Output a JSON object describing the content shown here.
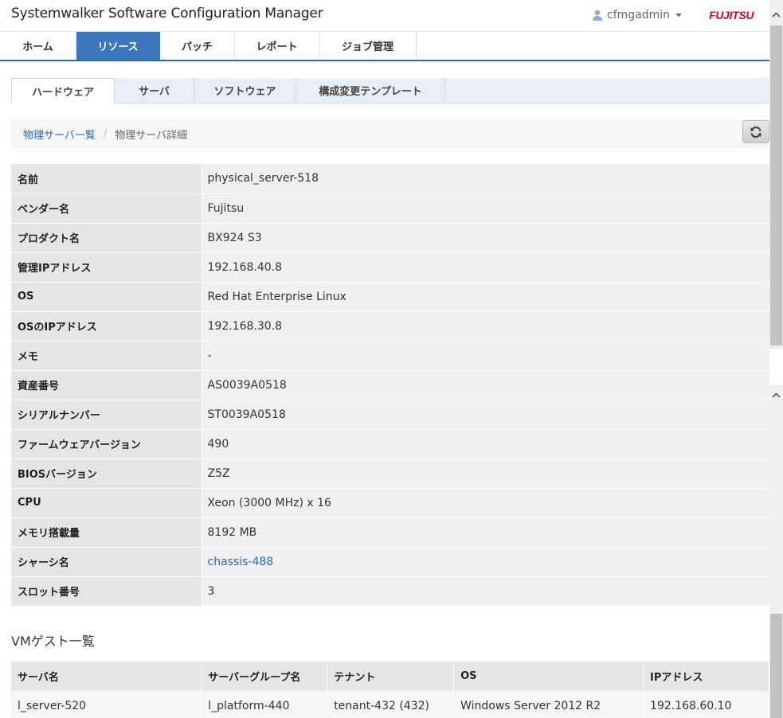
{
  "header": {
    "app_title": "Systemwalker Software Configuration Manager",
    "user_name": "cfmgadmin",
    "brand": "FUJITSU"
  },
  "main_nav": {
    "tabs": [
      {
        "label": "ホーム",
        "active": false
      },
      {
        "label": "リソース",
        "active": true
      },
      {
        "label": "パッチ",
        "active": false
      },
      {
        "label": "レポート",
        "active": false
      },
      {
        "label": "ジョブ管理",
        "active": false
      }
    ]
  },
  "sub_nav": {
    "tabs": [
      {
        "label": "ハードウェア",
        "active": true
      },
      {
        "label": "サーバ",
        "active": false
      },
      {
        "label": "ソフトウェア",
        "active": false
      },
      {
        "label": "構成変更テンプレート",
        "active": false
      }
    ]
  },
  "breadcrumb": {
    "parent": "物理サーバ一覧",
    "separator": "/",
    "current": "物理サーバ詳細"
  },
  "details": [
    {
      "label": "名前",
      "value": "physical_server-518"
    },
    {
      "label": "ベンダー名",
      "value": "Fujitsu"
    },
    {
      "label": "プロダクト名",
      "value": "BX924 S3"
    },
    {
      "label": "管理IPアドレス",
      "value": "192.168.40.8"
    },
    {
      "label": "OS",
      "value": "Red Hat Enterprise Linux"
    },
    {
      "label": "OSのIPアドレス",
      "value": "192.168.30.8"
    },
    {
      "label": "メモ",
      "value": "-"
    },
    {
      "label": "資産番号",
      "value": "AS0039A0518"
    },
    {
      "label": "シリアルナンバー",
      "value": "ST0039A0518"
    },
    {
      "label": "ファームウェアバージョン",
      "value": "490"
    },
    {
      "label": "BIOSバージョン",
      "value": "Z5Z"
    },
    {
      "label": "CPU",
      "value": "Xeon (3000 MHz) x 16"
    },
    {
      "label": "メモリ搭載量",
      "value": "8192 MB"
    },
    {
      "label": "シャーシ名",
      "value": "chassis-488",
      "link": true
    },
    {
      "label": "スロット番号",
      "value": "3"
    }
  ],
  "vm_section": {
    "title": "VMゲスト一覧",
    "columns": [
      "サーバ名",
      "サーバーグループ名",
      "テナント",
      "OS",
      "IPアドレス"
    ],
    "rows": [
      [
        "l_server-520",
        "l_platform-440",
        "tenant-432 (432)",
        "Windows Server 2012 R2",
        "192.168.60.10"
      ]
    ]
  },
  "colors": {
    "accent": "#3b75ba",
    "link": "#2a6ab1",
    "brand": "#e4001b"
  },
  "icons": {
    "user": "user-icon",
    "dropdown": "caret-down-icon",
    "refresh": "refresh-icon",
    "scroll_up": "chevron-up-icon"
  }
}
